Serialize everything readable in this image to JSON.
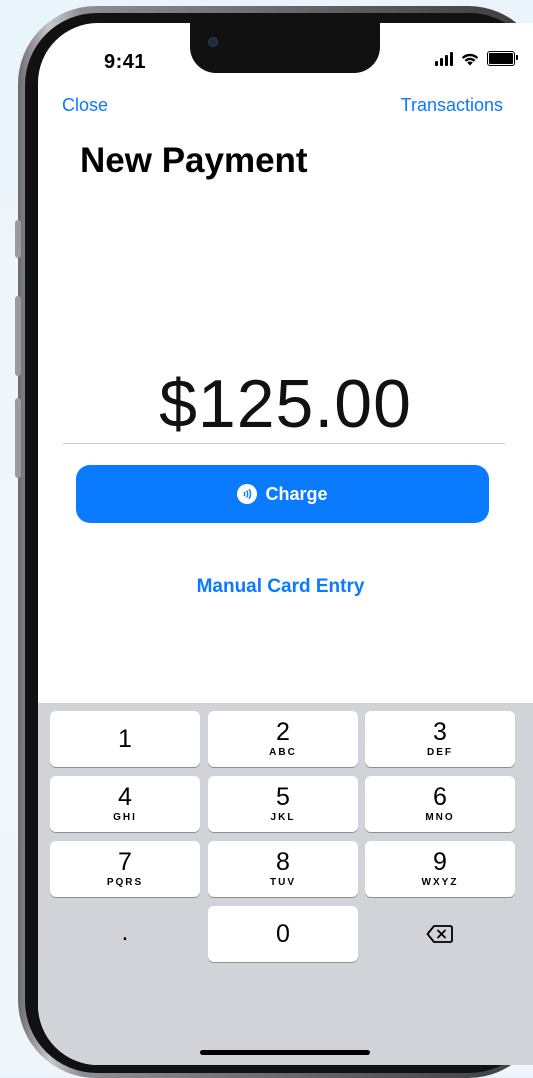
{
  "status_bar": {
    "time": "9:41",
    "icons": [
      "signal-icon",
      "wifi-icon",
      "battery-icon"
    ]
  },
  "nav": {
    "left_label": "Close",
    "right_label": "Transactions"
  },
  "page": {
    "title": "New Payment",
    "amount": "$125.00"
  },
  "actions": {
    "charge_label": "Charge",
    "charge_icon": "contactless-icon",
    "manual_entry_label": "Manual Card Entry"
  },
  "keypad": {
    "keys": [
      {
        "digit": "1",
        "letters": ""
      },
      {
        "digit": "2",
        "letters": "ABC"
      },
      {
        "digit": "3",
        "letters": "DEF"
      },
      {
        "digit": "4",
        "letters": "GHI"
      },
      {
        "digit": "5",
        "letters": "JKL"
      },
      {
        "digit": "6",
        "letters": "MNO"
      },
      {
        "digit": "7",
        "letters": "PQRS"
      },
      {
        "digit": "8",
        "letters": "TUV"
      },
      {
        "digit": "9",
        "letters": "WXYZ"
      },
      {
        "digit": "."
      },
      {
        "digit": "0"
      },
      {
        "icon": "backspace-icon"
      }
    ]
  },
  "colors": {
    "accent": "#0a7aff",
    "keypad_background": "#d1d3d9",
    "key_background": "#ffffff"
  }
}
